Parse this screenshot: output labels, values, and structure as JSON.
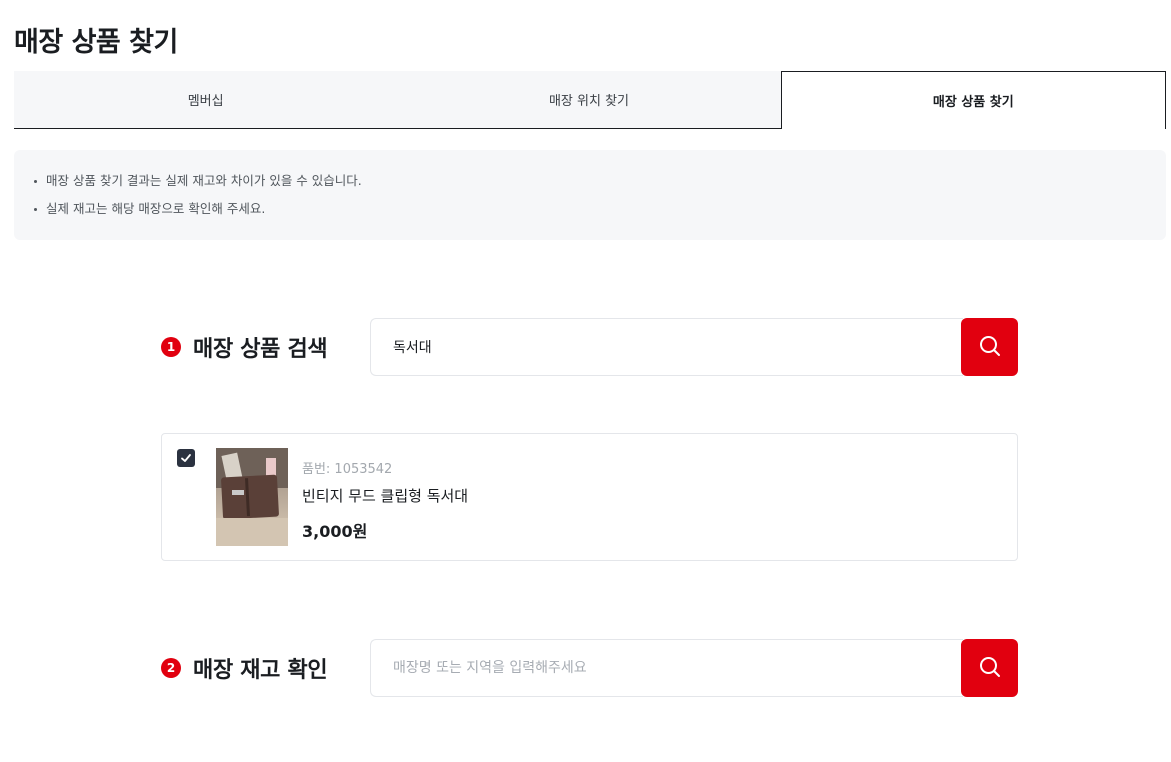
{
  "page": {
    "title": "매장 상품 찾기"
  },
  "tabs": [
    {
      "label": "멤버십",
      "active": false
    },
    {
      "label": "매장 위치 찾기",
      "active": false
    },
    {
      "label": "매장 상품 찾기",
      "active": true
    }
  ],
  "notice": {
    "items": [
      "매장 상품 찾기 결과는 실제 재고와 차이가 있을 수 있습니다.",
      "실제 재고는 해당 매장으로 확인해 주세요."
    ]
  },
  "product_search": {
    "step": "1",
    "title": "매장 상품 검색",
    "value": "독서대",
    "placeholder": "",
    "button_icon": "search-icon"
  },
  "product": {
    "checked": true,
    "code": "품번: 1053542",
    "name": "빈티지 무드 클립형 독서대",
    "price": "3,000원"
  },
  "stock_check": {
    "step": "2",
    "title": "매장 재고 확인",
    "value": "",
    "placeholder": "매장명 또는 지역을 입력해주세요",
    "button_icon": "search-icon"
  },
  "colors": {
    "accent": "#e1000f",
    "checkbox": "#2b3240",
    "panel_bg": "#f6f7f9"
  }
}
